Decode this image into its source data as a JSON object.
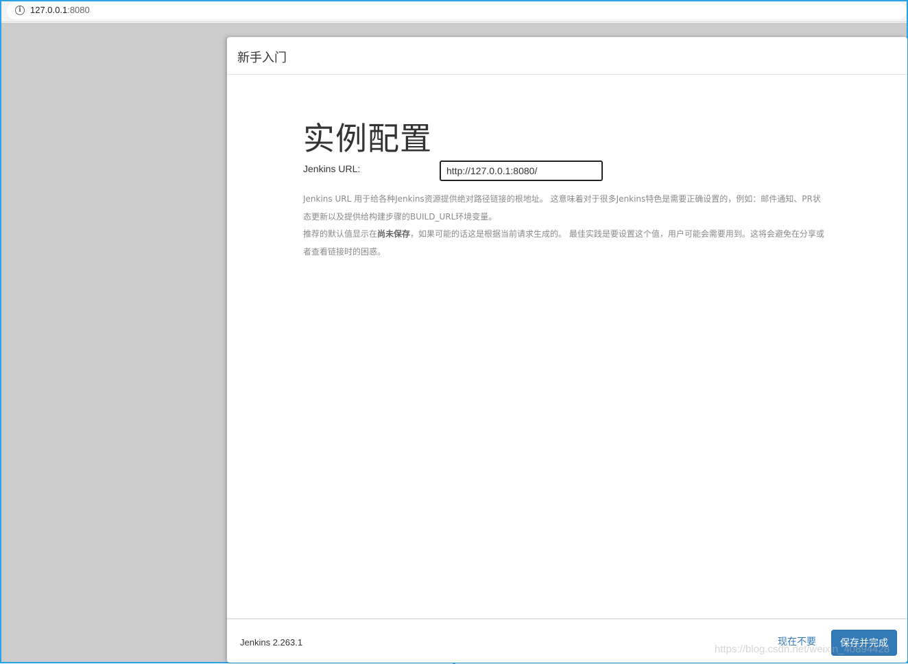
{
  "browser": {
    "url_host": "127.0.0.1",
    "url_port": ":8080"
  },
  "dialog": {
    "title": "新手入门",
    "heading": "实例配置",
    "url_label": "Jenkins URL:",
    "url_value": "http://127.0.0.1:8080/",
    "help": {
      "line1": "Jenkins URL 用于给各种Jenkins资源提供绝对路径链接的根地址。 这意味着对于很多Jenkins特色是需要正确设置的，例如：邮件通知、PR状态更新以及提供给构建步骤的BUILD_URL环境变量。",
      "line2_prefix": "推荐的默认值显示在",
      "line2_bold": "尚未保存",
      "line2_suffix": "，如果可能的话这是根据当前请求生成的。 最佳实践是要设置这个值，用户可能会需要用到。这将会避免在分享或者查看链接时的困惑。"
    },
    "footer": {
      "version": "Jenkins 2.263.1",
      "skip_label": "现在不要",
      "save_label": "保存并完成"
    }
  },
  "watermark": "https://blog.csdn.net/weixin_40894428",
  "colors": {
    "selection_frame": "#29a2e8",
    "primary_button": "#337ab7",
    "backdrop": "#cccccc"
  }
}
